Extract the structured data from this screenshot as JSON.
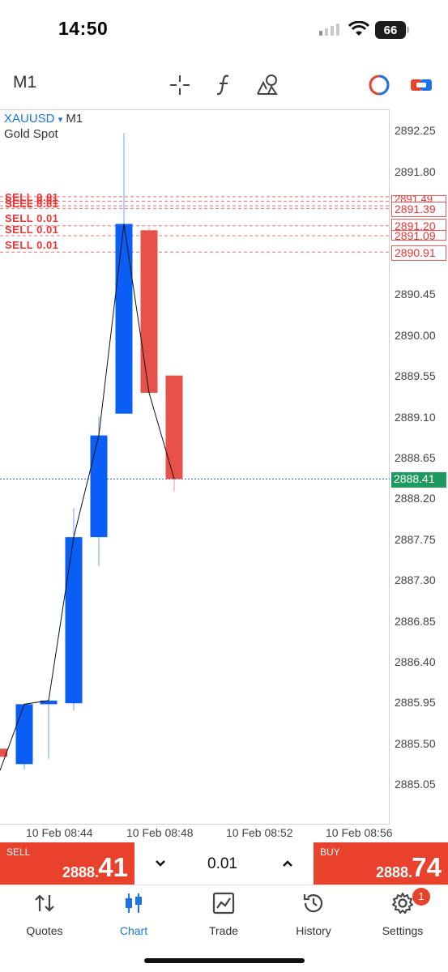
{
  "status_bar": {
    "time": "14:50",
    "battery": "66"
  },
  "toolbar": {
    "timeframe": "M1",
    "icons": [
      "crosshair-icon",
      "function-icon",
      "objects-icon",
      "toggle-icon",
      "link-icon"
    ]
  },
  "chart": {
    "symbol": "XAUUSD",
    "symbol_arrow": "▾",
    "timeframe": "M1",
    "description": "Gold Spot",
    "y_ticks": [
      "2892.25",
      "2891.80",
      "2890.45",
      "2890.00",
      "2889.55",
      "2889.10",
      "2888.65",
      "2888.20",
      "2887.75",
      "2887.30",
      "2886.85",
      "2886.40",
      "2885.95",
      "2885.50",
      "2885.05"
    ],
    "x_ticks": [
      "10 Feb 08:44",
      "10 Feb 08:48",
      "10 Feb 08:52",
      "10 Feb 08:56"
    ],
    "order_price_labels": [
      "2891.39",
      "2891.20",
      "2891.09",
      "2890.91"
    ],
    "current_price": "2888.41",
    "order_labels": [
      "SELL 0.01",
      "SELL 0.01",
      "SELL 0.01",
      "SELL 0.01",
      "SELL 0.01",
      "SELL 0.01"
    ]
  },
  "chart_data": {
    "type": "candlestick",
    "candles": [
      {
        "open": 2885.44,
        "close": 2885.35,
        "color": "#e8504a"
      },
      {
        "open": 2885.27,
        "close": 2885.93,
        "high": 2885.93,
        "low": 2885.21,
        "color": "#0a5ef5"
      },
      {
        "open": 2885.93,
        "close": 2885.97,
        "high": 2885.97,
        "low": 2885.33,
        "color": "#0a5ef5"
      },
      {
        "open": 2885.94,
        "close": 2887.77,
        "high": 2888.09,
        "low": 2885.86,
        "color": "#0a5ef5"
      },
      {
        "open": 2887.77,
        "close": 2888.89,
        "high": 2889.1,
        "low": 2887.45,
        "color": "#0a5ef5"
      },
      {
        "open": 2889.13,
        "close": 2891.22,
        "high": 2892.22,
        "low": 2889.13,
        "color": "#0a5ef5"
      },
      {
        "open": 2891.15,
        "close": 2889.36,
        "high": 2891.18,
        "low": 2889.36,
        "color": "#e8504a"
      },
      {
        "open": 2889.55,
        "close": 2888.41,
        "high": 2889.55,
        "low": 2888.27,
        "color": "#e8504a"
      }
    ],
    "sell_orders": [
      2891.52,
      2891.47,
      2891.42,
      2891.39,
      2891.2,
      2891.09,
      2890.91
    ],
    "current": 2888.41,
    "ylim": [
      2884.81,
      2892.45
    ]
  },
  "trade": {
    "sell_label": "SELL",
    "sell_price_small": "2888.",
    "sell_price_big": "41",
    "buy_label": "BUY",
    "buy_price_small": "2888.",
    "buy_price_big": "74",
    "volume": "0.01",
    "down": "⌄",
    "up": "⌃"
  },
  "tabs": [
    {
      "label": "Quotes",
      "icon": "quotes-icon"
    },
    {
      "label": "Chart",
      "icon": "chart-icon"
    },
    {
      "label": "Trade",
      "icon": "trade-icon"
    },
    {
      "label": "History",
      "icon": "history-icon"
    },
    {
      "label": "Settings",
      "icon": "settings-icon"
    }
  ],
  "settings_badge": "1",
  "colors": {
    "bull": "#0a5ef5",
    "bear": "#e8504a",
    "accent": "#1a73e8",
    "trade": "#e8412c",
    "current": "#1e9a5e"
  }
}
